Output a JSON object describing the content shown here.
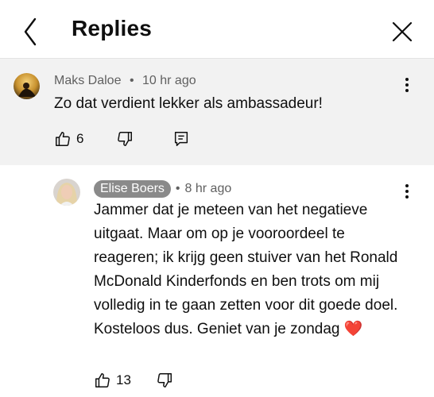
{
  "header": {
    "title": "Replies"
  },
  "comments": [
    {
      "author": "Maks Daloe",
      "separator": "•",
      "time": "10 hr ago",
      "text": "Zo dat verdient lekker als ambassadeur!",
      "likes": "6"
    },
    {
      "author": "Elise Boers",
      "separator": "•",
      "time": "8 hr ago",
      "text": "Jammer dat je meteen van het negatieve uitgaat. Maar om op je vooroordeel te reageren; ik krijg geen stuiver van het Ronald McDonald Kinderfonds en ben trots om mij volledig in te gaan zetten voor dit goede doel. Kosteloos dus. Geniet van je zondag",
      "emoji": "❤️",
      "likes": "13"
    }
  ],
  "colors": {
    "highlight_bg": "#f2f2f2",
    "chip_bg": "#8a8a8a",
    "meta_text": "#606060",
    "heart": "#d62a2a"
  },
  "icons": [
    "back-icon",
    "close-icon",
    "thumbs-up-icon",
    "thumbs-down-icon",
    "reply-icon",
    "more-options-icon"
  ]
}
